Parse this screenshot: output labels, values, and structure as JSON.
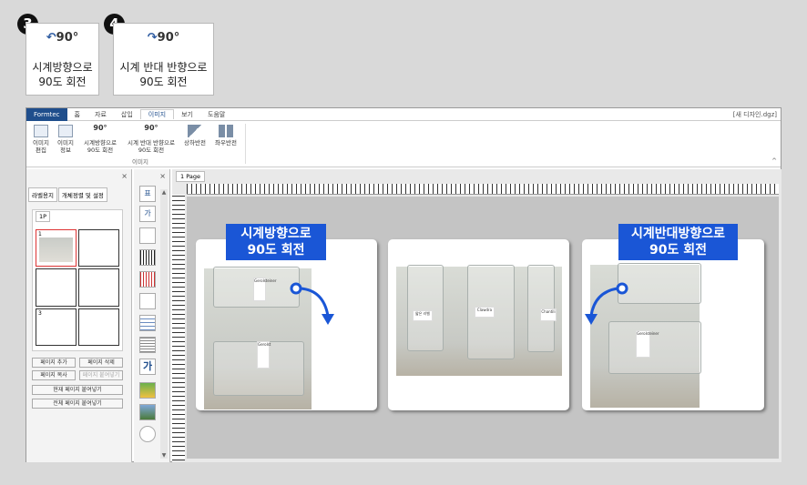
{
  "callouts": [
    {
      "number": "3",
      "icon_text": "90°",
      "label_line1": "시계방향으로",
      "label_line2": "90도 회전"
    },
    {
      "number": "4",
      "icon_text": "90°",
      "label_line1": "시계 반대 반향으로",
      "label_line2": "90도 회전"
    }
  ],
  "app": {
    "brand": "Formtec",
    "tabs": [
      "홈",
      "자료",
      "삽입",
      "이미지",
      "보기",
      "도움말"
    ],
    "active_tab": "이미지",
    "window_title": "[새 디자인.dgz]"
  },
  "ribbon": {
    "buttons": [
      {
        "line1": "이미지",
        "line2": "편집",
        "icon": "image-edit-icon"
      },
      {
        "line1": "이미지",
        "line2": "정보",
        "icon": "image-info-icon"
      },
      {
        "line1": "시계방향으로",
        "line2": "90도 회전",
        "icon": "rotate-cw-icon",
        "icon_text": "90°"
      },
      {
        "line1": "시계 반대 반향으로",
        "line2": "90도 회전",
        "icon": "rotate-ccw-icon",
        "icon_text": "90°"
      },
      {
        "line1": "상하반전",
        "line2": "",
        "icon": "flip-vertical-icon"
      },
      {
        "line1": "좌우반전",
        "line2": "",
        "icon": "flip-horizontal-icon"
      }
    ],
    "group_label": "이미지",
    "collapse": "^"
  },
  "left_panel": {
    "close": "×",
    "tabs": [
      "라벨용지",
      "개체정렬 및 설정"
    ],
    "page_tab": "1P",
    "thumbs": [
      {
        "n": "1"
      },
      {
        "n": ""
      },
      {
        "n": ""
      },
      {
        "n": ""
      },
      {
        "n": "3"
      },
      {
        "n": ""
      }
    ],
    "buttons": [
      "페이지 추가",
      "페이지 삭제",
      "페이지 복사",
      "페이지 붙여넣기",
      "현재 페이지 붙여넣기",
      "전체 페이지 붙여넣기"
    ]
  },
  "tools": {
    "close": "×",
    "items": [
      "표",
      "가",
      "img",
      "barcode",
      "barcode2",
      "picture",
      "table",
      "lines",
      "가",
      "image",
      "photo",
      "cd"
    ],
    "scroll_up": "▲",
    "scroll_down": "▼"
  },
  "editor": {
    "tab": "1 Page",
    "ruler_labels": [
      "11",
      "12",
      "13",
      "14",
      "15",
      "16",
      "17",
      "18",
      "19",
      "20"
    ],
    "captions": [
      {
        "line1": "시계방향으로",
        "line2": "90도 회전"
      },
      {
        "line1": "시계반대방향으로",
        "line2": "90도 회전"
      }
    ],
    "tags": [
      "Gerolsteiner",
      "Gerolst",
      "얇은 라벨",
      "Clawdra",
      "Chantili",
      "Gerolsteiner"
    ]
  },
  "colors": {
    "accent": "#1a56d6",
    "brand": "#1f4e8c"
  }
}
